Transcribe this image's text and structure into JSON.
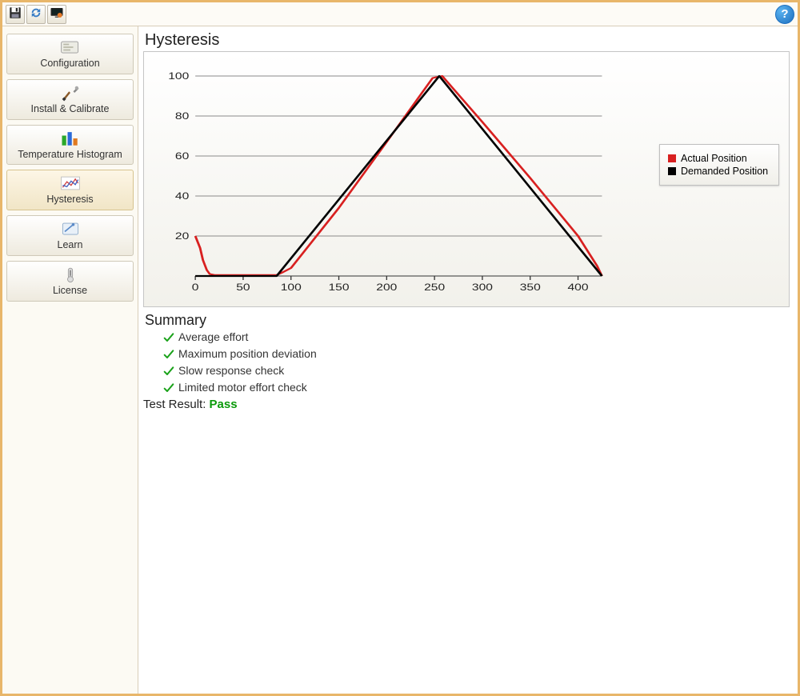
{
  "toolbar": {
    "help_label": "?"
  },
  "sidebar": {
    "items": [
      {
        "label": "Configuration"
      },
      {
        "label": "Install & Calibrate"
      },
      {
        "label": "Temperature Histogram"
      },
      {
        "label": "Hysteresis"
      },
      {
        "label": "Learn"
      },
      {
        "label": "License"
      }
    ]
  },
  "main": {
    "chart_title": "Hysteresis",
    "legend": {
      "actual": {
        "label": "Actual Position",
        "color": "#d82020"
      },
      "demanded": {
        "label": "Demanded Position",
        "color": "#000000"
      }
    },
    "summary_title": "Summary",
    "summary_items": [
      "Average effort",
      "Maximum position deviation",
      "Slow response check",
      "Limited motor effort check"
    ],
    "test_result": {
      "label": "Test Result:",
      "value": "Pass"
    }
  },
  "chart_data": {
    "type": "line",
    "title": "Hysteresis",
    "xlabel": "",
    "ylabel": "",
    "xlim": [
      0,
      425
    ],
    "ylim": [
      0,
      100
    ],
    "x_ticks": [
      0,
      50,
      100,
      150,
      200,
      250,
      300,
      350,
      400
    ],
    "y_ticks": [
      20,
      40,
      60,
      80,
      100
    ],
    "series": [
      {
        "name": "Actual Position",
        "color": "#d82020",
        "x": [
          0,
          5,
          8,
          12,
          15,
          20,
          60,
          85,
          92,
          100,
          150,
          200,
          248,
          258,
          300,
          350,
          400,
          420,
          425
        ],
        "y": [
          20,
          14,
          8,
          3,
          1,
          0.5,
          0.5,
          0.5,
          2,
          4,
          34,
          67,
          99,
          100,
          77,
          49,
          20,
          5,
          0
        ]
      },
      {
        "name": "Demanded Position",
        "color": "#000000",
        "x": [
          0,
          85,
          255,
          425
        ],
        "y": [
          0,
          0,
          100,
          0
        ]
      }
    ],
    "legend_position": "right"
  }
}
